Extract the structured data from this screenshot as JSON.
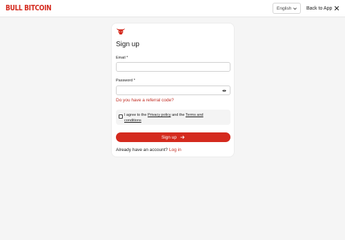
{
  "header": {
    "logo_text": "BULL BITCOIN",
    "language": "English",
    "back_label": "Back to App"
  },
  "form": {
    "title": "Sign up",
    "email_label": "Email",
    "password_label": "Password",
    "required_mark": "*",
    "referral_link": "Do you have a referral code?",
    "agree": {
      "prefix": "I agree to the",
      "privacy": "Privacy policy",
      "middle": "and the",
      "terms": "Terms and conditions"
    },
    "signup_button": "Sign up",
    "login_prompt": "Already have an account?",
    "login_link": "Log in"
  },
  "colors": {
    "brand": "#d42a1e",
    "link": "#c0281e",
    "background": "#f5f5f5"
  },
  "icons": [
    "bull-logo-icon",
    "chevron-down-icon",
    "close-icon",
    "eye-icon",
    "arrow-right-icon"
  ]
}
